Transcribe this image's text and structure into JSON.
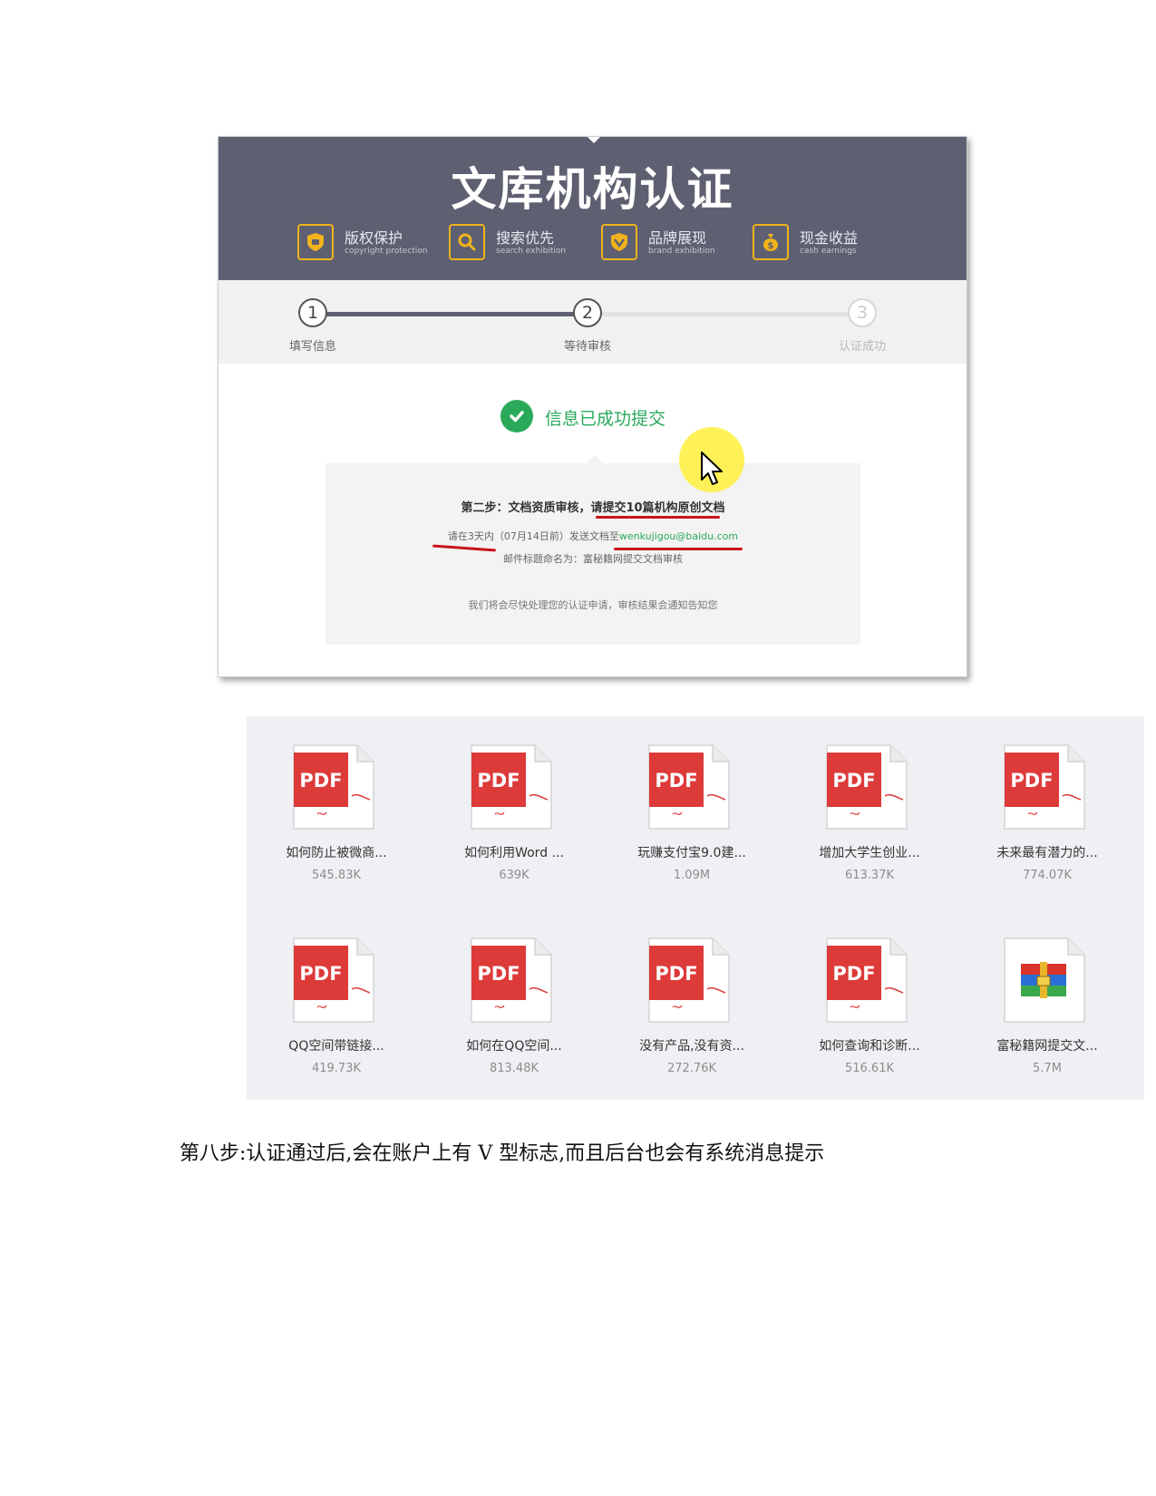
{
  "header": {
    "title": "文库机构认证",
    "features": [
      {
        "label": "版权保护",
        "sub": "copyright protection",
        "icon": "shield-icon"
      },
      {
        "label": "搜索优先",
        "sub": "search exhibition",
        "icon": "search-icon"
      },
      {
        "label": "品牌展现",
        "sub": "brand exhibition",
        "icon": "brand-badge-icon"
      },
      {
        "label": "现金收益",
        "sub": "cash earnings",
        "icon": "money-bag-icon"
      }
    ]
  },
  "steps": [
    {
      "number": "1",
      "label": "填写信息"
    },
    {
      "number": "2",
      "label": "等待审核"
    },
    {
      "number": "3",
      "label": "认证成功"
    }
  ],
  "status": {
    "message": "信息已成功提交"
  },
  "info": {
    "line1_prefix": "第二步：文档资质审核，",
    "line1_highlight": "请提交10篇机构原创文档",
    "line2_prefix": "请在",
    "line2_days": "3天内",
    "line2_middle": "（07月14日前）发送文档至",
    "line2_email": "wenkujigou@baidu.com",
    "line3": "邮件标题命名为：富秘籍网提交文档审核",
    "line4": "我们将会尽快处理您的认证申请，审核结果会通知告知您"
  },
  "files": [
    {
      "name": "如何防止被微商...",
      "size": "545.83K",
      "type": "pdf"
    },
    {
      "name": "如何利用Word ...",
      "size": "639K",
      "type": "pdf"
    },
    {
      "name": "玩赚支付宝9.0建...",
      "size": "1.09M",
      "type": "pdf"
    },
    {
      "name": "增加大学生创业...",
      "size": "613.37K",
      "type": "pdf"
    },
    {
      "name": "未来最有潜力的...",
      "size": "774.07K",
      "type": "pdf"
    },
    {
      "name": "QQ空间带链接...",
      "size": "419.73K",
      "type": "pdf"
    },
    {
      "name": "如何在QQ空间...",
      "size": "813.48K",
      "type": "pdf"
    },
    {
      "name": "没有产品,没有资...",
      "size": "272.76K",
      "type": "pdf"
    },
    {
      "name": "如何查询和诊断...",
      "size": "516.61K",
      "type": "pdf"
    },
    {
      "name": "富秘籍网提交文...",
      "size": "5.7M",
      "type": "rar"
    }
  ],
  "pdf_badge": "PDF",
  "caption": "第八步:认证通过后,会在账户上有 V 型标志,而且后台也会有系统消息提示",
  "colors": {
    "header_bg": "#5e6072",
    "accent_gold": "#f2b31b",
    "success_green": "#2aa95b",
    "pdf_red": "#dd3a3a",
    "underline_red": "#c8141d"
  }
}
